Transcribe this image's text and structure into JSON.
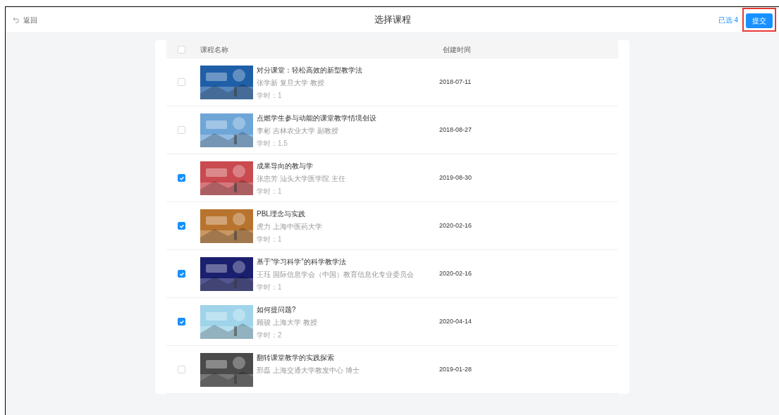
{
  "header": {
    "back": "返回",
    "title": "选择课程",
    "selected_count": "已选 4",
    "submit": "提交"
  },
  "table": {
    "all_checked": false,
    "columns": [
      "课程名称",
      "创建时间"
    ],
    "rows": [
      {
        "checked": false,
        "title": "对分课堂：轻松高效的新型教学法",
        "teacher": "张学新 复旦大学 教授",
        "hours": "学时：1",
        "date": "2018-07-11",
        "color": "#1f5fa8"
      },
      {
        "checked": false,
        "title": "点燃学生参与动能的课堂教学情境创设",
        "teacher": "李彬 吉林农业大学 副教授",
        "hours": "学时：1.5",
        "date": "2018-08-27",
        "color": "#6fa6d8"
      },
      {
        "checked": true,
        "title": "成果导向的教与学",
        "teacher": "张忠芳 汕头大学医学院 主任",
        "hours": "学时：1",
        "date": "2019-08-30",
        "color": "#c94a4f"
      },
      {
        "checked": true,
        "title": "PBL理念与实践",
        "teacher": "虎力 上海中医药大学",
        "hours": "学时：1",
        "date": "2020-02-16",
        "color": "#b8742e"
      },
      {
        "checked": true,
        "title": "基于“学习科学”的科学教学法",
        "teacher": "王珏 国际信息学会（中国）教育信息化专业委员会",
        "hours": "学时：1",
        "date": "2020-02-16",
        "color": "#1a1f6e"
      },
      {
        "checked": true,
        "title": "如何提问题?",
        "teacher": "顾骏 上海大学 教授",
        "hours": "学时：2",
        "date": "2020-04-14",
        "color": "#9fd4ea"
      },
      {
        "checked": false,
        "title": "翻转课堂教学的实践探索",
        "teacher": "邢磊 上海交通大学教发中心 博士",
        "date": "2019-01-28",
        "color": "#4a4a4a"
      }
    ]
  }
}
